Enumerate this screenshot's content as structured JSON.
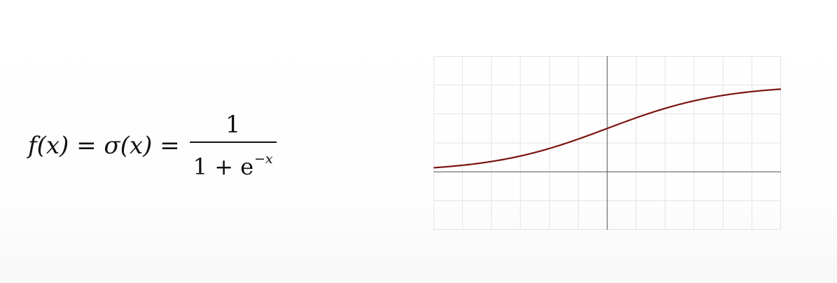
{
  "formula": {
    "lhs": "f(x) = σ(x) =",
    "numerator": "1",
    "denominator_base": "1 + e",
    "denominator_exponent": "−x"
  },
  "chart_data": {
    "type": "line",
    "title": "",
    "xlabel": "",
    "ylabel": "",
    "xlim": [
      -6,
      6
    ],
    "ylim": [
      -2,
      4
    ],
    "x_step": 1,
    "y_step": 1,
    "grid": true,
    "series": [
      {
        "function": "sigmoid",
        "color": "#7a1410",
        "x": [
          -6,
          -5,
          -4,
          -3,
          -2,
          -1,
          0,
          1,
          2,
          3,
          4,
          5,
          6
        ],
        "y": [
          0.1,
          0.2,
          0.3,
          0.5,
          0.8,
          1.2,
          1.5,
          1.8,
          2.2,
          2.5,
          2.7,
          2.8,
          2.9
        ]
      }
    ],
    "colors": {
      "grid": "#e3e3e3",
      "axis": "#6a6a6a"
    }
  }
}
